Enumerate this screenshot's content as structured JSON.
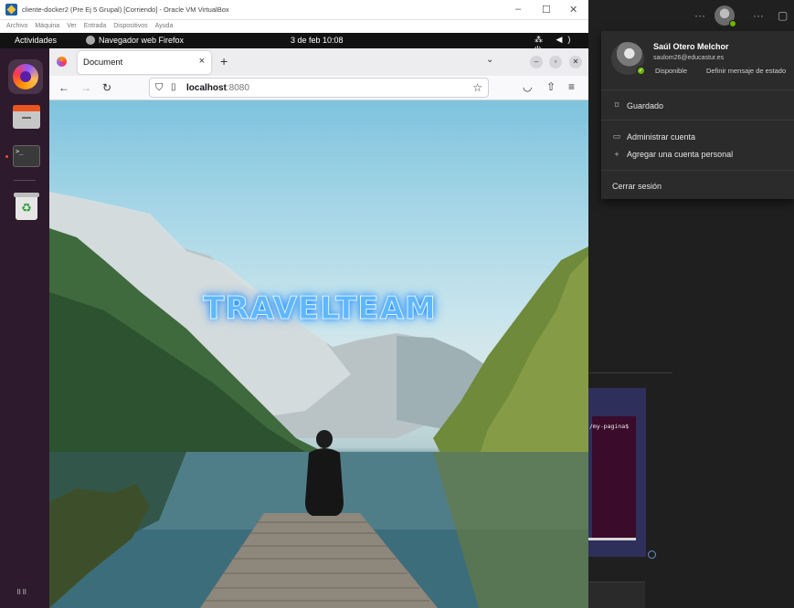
{
  "vbox": {
    "title": "cliente-docker2 (Pre Ej 5 Grupal) [Corriendo] - Oracle VM VirtualBox",
    "menu": [
      "Archivo",
      "Máquina",
      "Ver",
      "Entrada",
      "Dispositivos",
      "Ayuda"
    ],
    "controls": {
      "minimize": "–",
      "maximize": "☐",
      "close": "✕"
    }
  },
  "ubuntu": {
    "activities": "Actividades",
    "app_name": "Navegador web Firefox",
    "clock": "3 de feb  10:08",
    "sys_icons": "⁂ ◀) ⏻"
  },
  "dock": {
    "items": [
      "firefox-icon",
      "files-icon",
      "terminal-icon",
      "trash-icon",
      "app-grid-icon"
    ],
    "terminal_prompt": ">_",
    "trash_glyph": "♻",
    "apps_glyph": "⠿⠿"
  },
  "firefox": {
    "tab_title": "Document",
    "tab_close": "×",
    "new_tab": "+",
    "tab_list": "⌄",
    "url_host": "localhost",
    "url_port": ":8080",
    "nav": {
      "back": "←",
      "forward": "→",
      "reload": "↻"
    },
    "star": "☆",
    "tools": {
      "pocket": "◡",
      "extensions": "⇧",
      "menu": "≡"
    },
    "window_controls": {
      "minimize": "–",
      "maximize": "▫",
      "close": "✕"
    }
  },
  "page": {
    "heading": "TRAVELTEAM"
  },
  "account_panel": {
    "name": "Saúl Otero Melchor",
    "email": "saulom26@educastur.es",
    "status": "Disponible",
    "set_status_message": "Definir mensaje de estado",
    "items": [
      {
        "label": "Guardado",
        "icon": "bookmark-icon",
        "glyph": "⌑"
      },
      {
        "label": "Administrar cuenta",
        "icon": "id-card-icon",
        "glyph": "▭"
      },
      {
        "label": "Agregar una cuenta personal",
        "icon": "plus-icon",
        "glyph": "+"
      },
      {
        "label": "Cerrar sesión",
        "icon": "",
        "glyph": ""
      }
    ]
  },
  "host": {
    "more": "···",
    "more2": "···",
    "window_btn": "▢",
    "terminal_text": "/my-pagina$"
  },
  "colors": {
    "ubuntu_dock": "#2d1a2c",
    "ubuntu_accent": "#e95420",
    "teams_bg": "#1f1f1f",
    "status_green": "#6bb700",
    "neon_title": "#5fb7ff"
  }
}
